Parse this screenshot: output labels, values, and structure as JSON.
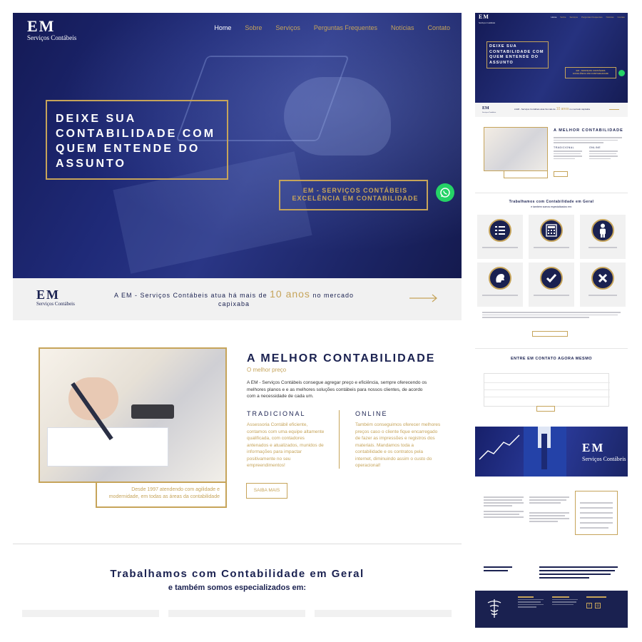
{
  "nav": {
    "items": [
      "Home",
      "Sobre",
      "Serviços",
      "Perguntas Frequentes",
      "Notícias",
      "Contato"
    ]
  },
  "brand": {
    "mark": "EM",
    "subtitle": "Serviços Contábeis"
  },
  "hero": {
    "title": "DEIXE SUA CONTABILIDADE COM QUEM ENTENDE DO ASSUNTO",
    "tagline_1": "EM - SERVIÇOS CONTÁBEIS",
    "tagline_2": "EXCELÊNCIA EM CONTABILIDADE"
  },
  "strip": {
    "text_before": "A EM - Serviços Contábeis atua há mais de",
    "highlight": "10 anos",
    "text_after": "no mercado capixaba"
  },
  "about": {
    "title": "A MELHOR CONTABILIDADE",
    "subtitle": "O melhor preço",
    "paragraph": "A EM - Serviços Contábeis consegue agregar preço e eficiência, sempre oferecendo os melhores planos e e as melhores soluções contábeis para nossos clientes, de acordo com a necessidade de cada um.",
    "caption": "Desde 1997 atendendo com agilidade e modernidade, em todas as áreas da contabilidade",
    "col1": {
      "title": "TRADICIONAL",
      "text": "Assessoria Contábil eficiente, contamos com uma equipe altamente qualificada, com contadores antenados e atualizados, munidos de informações para impactar positivamente no seu empreendimentos!"
    },
    "col2": {
      "title": "ONLINE",
      "text": "Também conseguimos oferecer melhores preços caso o cliente fique encarregado de fazer as impressões e registros dos materiais. Mandamos toda a contabilidade e os contratos pela internet, diminuindo assim o custo do operacional!"
    },
    "button": "SAIBA MAIS"
  },
  "services": {
    "title": "Trabalhamos com Contabilidade em Geral",
    "subtitle": "e também somos especializados em:"
  },
  "colors": {
    "navy": "#1a2150",
    "gold": "#c6a45a",
    "whatsapp": "#25d366"
  },
  "icons": [
    "whatsapp-icon",
    "arrow-right-icon",
    "list-icon",
    "calculator-icon",
    "person-icon",
    "lion-icon",
    "check-icon",
    "x-icon",
    "facebook-icon",
    "instagram-icon",
    "caduceus-icon"
  ]
}
